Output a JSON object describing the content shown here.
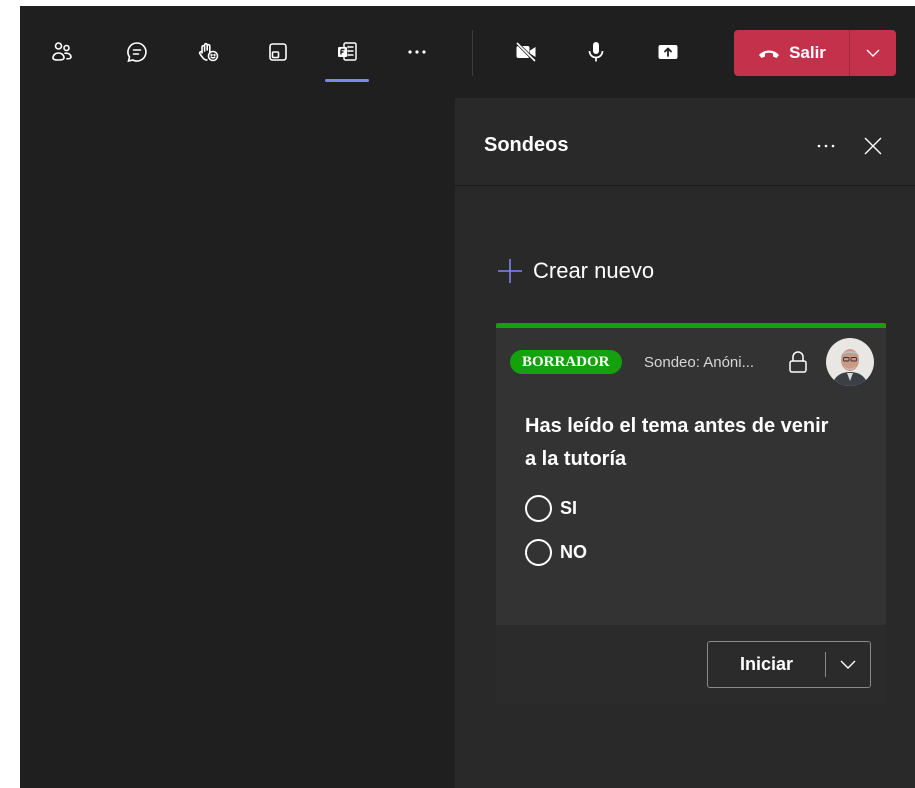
{
  "toolbar": {
    "buttons": [
      {
        "icon": "people-icon"
      },
      {
        "icon": "chat-icon"
      },
      {
        "icon": "raise-hand-icon"
      },
      {
        "icon": "rooms-icon"
      },
      {
        "icon": "apps-icon",
        "active": true
      },
      {
        "icon": "more-icon"
      },
      {
        "icon": "camera-off-icon"
      },
      {
        "icon": "microphone-icon"
      },
      {
        "icon": "share-icon"
      }
    ],
    "leave_label": "Salir",
    "active_color": "#7f85f5",
    "leave_color": "#c4314b"
  },
  "panel": {
    "title": "Sondeos",
    "create_label": "Crear nuevo",
    "poll": {
      "status": "BORRADOR",
      "status_color": "#13a10e",
      "meta": "Sondeo: Anóni...",
      "question": "Has leído el tema antes de venir a la tutoría",
      "options": [
        "SI",
        "NO"
      ],
      "start_label": "Iniciar"
    }
  }
}
